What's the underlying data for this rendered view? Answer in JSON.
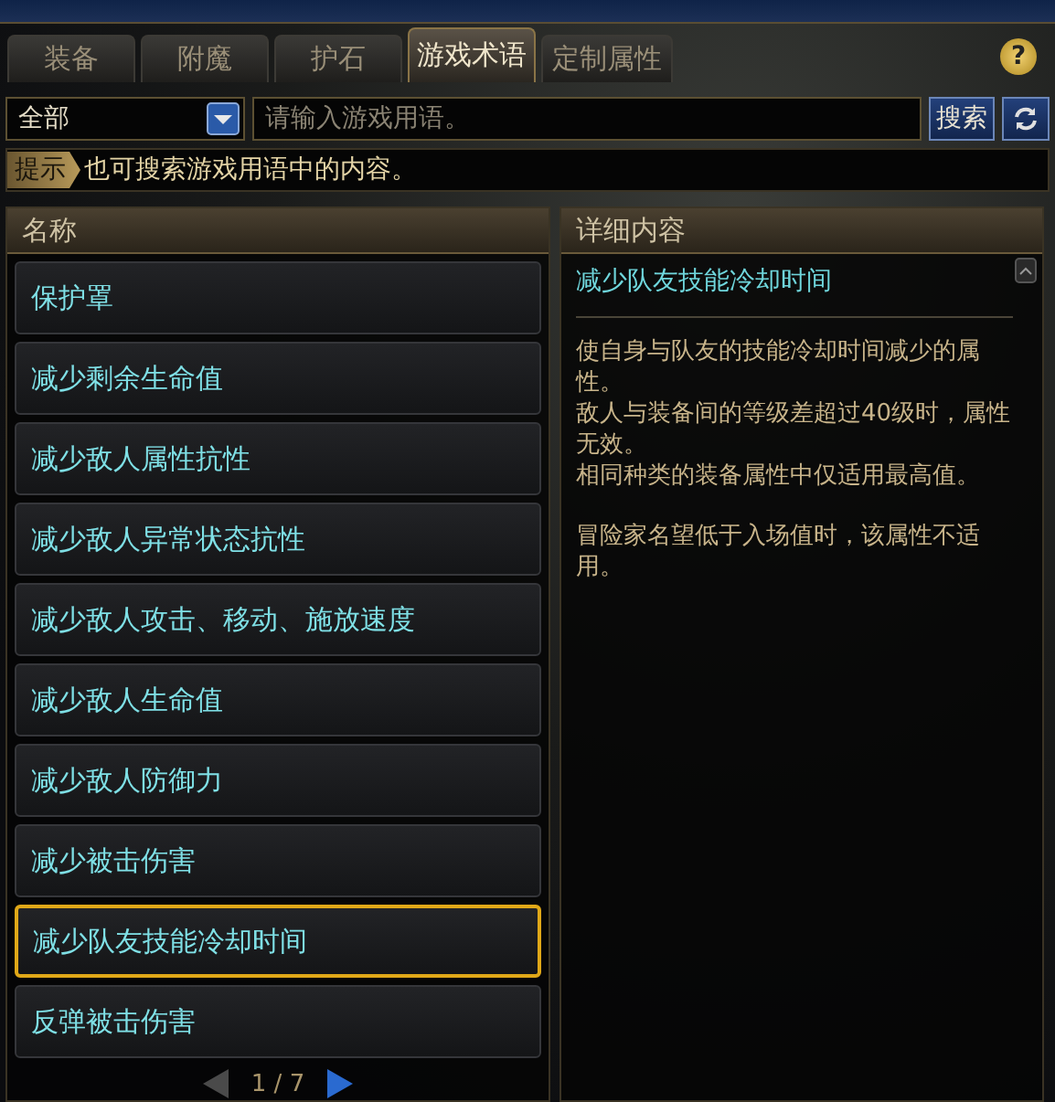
{
  "tabs": [
    {
      "label": "装备",
      "selected": false
    },
    {
      "label": "附魔",
      "selected": false
    },
    {
      "label": "护石",
      "selected": false
    },
    {
      "label": "游戏术语",
      "selected": true
    },
    {
      "label": "定制属性",
      "selected": false
    }
  ],
  "help_button": {
    "label": "?"
  },
  "search": {
    "category": "全部",
    "placeholder": "请输入游戏用语。",
    "button": "搜索"
  },
  "hint": {
    "tag": "提示",
    "text": "也可搜索游戏用语中的内容。"
  },
  "list": {
    "header": "名称",
    "items": [
      {
        "label": "保护罩",
        "selected": false
      },
      {
        "label": "减少剩余生命值",
        "selected": false
      },
      {
        "label": "减少敌人属性抗性",
        "selected": false
      },
      {
        "label": "减少敌人异常状态抗性",
        "selected": false
      },
      {
        "label": "减少敌人攻击、移动、施放速度",
        "selected": false
      },
      {
        "label": "减少敌人生命值",
        "selected": false
      },
      {
        "label": "减少敌人防御力",
        "selected": false
      },
      {
        "label": "减少被击伤害",
        "selected": false
      },
      {
        "label": "减少队友技能冷却时间",
        "selected": true
      },
      {
        "label": "反弹被击伤害",
        "selected": false
      }
    ]
  },
  "pager": {
    "text": "1 / 7",
    "prev_disabled": true,
    "next_disabled": false
  },
  "detail": {
    "header": "详细内容",
    "title": "减少队友技能冷却时间",
    "paragraphs": [
      [
        "使自身与队友的技能冷却时间减少的属性。",
        "敌人与装备间的等级差超过40级时，属性无效。",
        "相同种类的装备属性中仅适用最高值。"
      ],
      [
        "冒险家名望低于入场值时，该属性不适用。"
      ]
    ]
  }
}
